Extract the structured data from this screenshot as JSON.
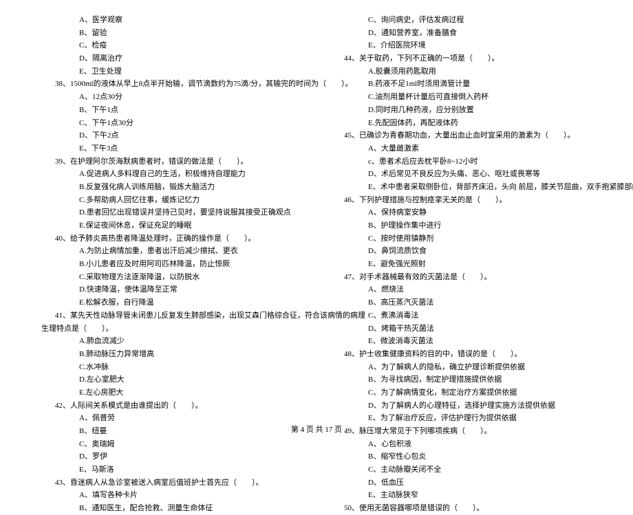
{
  "left_column": [
    {
      "type": "option",
      "text": "A、医学观察"
    },
    {
      "type": "option",
      "text": "B、留验"
    },
    {
      "type": "option",
      "text": "C、检疫"
    },
    {
      "type": "option",
      "text": "D、隔离治疗"
    },
    {
      "type": "option",
      "text": "E、卫生处理"
    },
    {
      "type": "question",
      "text": "38、1500ml的液体从早上8点半开始输，调节滴数约为75滴/分，其输完的时间为（　　）。"
    },
    {
      "type": "option",
      "text": "A、12点30分"
    },
    {
      "type": "option",
      "text": "B、下午1点"
    },
    {
      "type": "option",
      "text": "C、下午1点30分"
    },
    {
      "type": "option",
      "text": "D、下午2点"
    },
    {
      "type": "option",
      "text": "E、下午3点"
    },
    {
      "type": "question",
      "text": "39、在护理阿尔茨海默病患者时，错误的做法是（　　）。"
    },
    {
      "type": "option",
      "text": "A.促进病人多料理自己的生活，积极维持自理能力"
    },
    {
      "type": "option",
      "text": "B.反复强化病人训练用脑，锻炼大脑活力"
    },
    {
      "type": "option",
      "text": "C.多帮助病人回忆往事，缓炼记忆力"
    },
    {
      "type": "option",
      "text": "D.患者回忆出现错误并坚持己见时，要坚持说服其接受正确观点"
    },
    {
      "type": "option",
      "text": "E.保证夜间休息，保证充足的睡眠"
    },
    {
      "type": "question",
      "text": "40、给予肺炎高热患者降温处理时，正确的操作是（　　）。"
    },
    {
      "type": "option",
      "text": "A.为防止病情加重，患者出汗后减少擦拭、更衣"
    },
    {
      "type": "option",
      "text": "B.小儿患者应及时用阿司匹林降温，防止惊厥"
    },
    {
      "type": "option",
      "text": "C.采取物理方法逐渐降温，以防脱水"
    },
    {
      "type": "option",
      "text": "D.快速降温，使体温降至正常"
    },
    {
      "type": "option",
      "text": "E.松解衣服，自行降温"
    },
    {
      "type": "question",
      "text": "41、某先天性动脉导管未闭患儿反复发生肺部感染，出现艾森门格综合征，符合该病情的病理"
    },
    {
      "type": "question-sub",
      "text": "生理特点是（　　）。"
    },
    {
      "type": "option",
      "text": "A.肺血流减少"
    },
    {
      "type": "option",
      "text": "B.肺动脉压力异常增高"
    },
    {
      "type": "option",
      "text": "C.水冲脉"
    },
    {
      "type": "option",
      "text": "D.左心室肥大"
    },
    {
      "type": "option",
      "text": "E.左心房肥大"
    },
    {
      "type": "question",
      "text": "42、人际间关系模式是由谁提出的（　　）。"
    },
    {
      "type": "option",
      "text": "A、佩普劳"
    },
    {
      "type": "option",
      "text": "B、纽曼"
    },
    {
      "type": "option",
      "text": "C、奥瑞姆"
    },
    {
      "type": "option",
      "text": "D、罗伊"
    },
    {
      "type": "option",
      "text": "E、马斯洛"
    },
    {
      "type": "question",
      "text": "43、昏迷病人从急诊室被送入病室后值班护士首先应（　　）。"
    },
    {
      "type": "option",
      "text": "A、填写各种卡片"
    },
    {
      "type": "option",
      "text": "B、通知医生，配合抢救、测量生命体征"
    }
  ],
  "right_column": [
    {
      "type": "option",
      "text": "C、询问病史，评估发病过程"
    },
    {
      "type": "option",
      "text": "D、通知营养室，准备膳食"
    },
    {
      "type": "option",
      "text": "E、介绍医院环境"
    },
    {
      "type": "question",
      "text": "44、关于取药，下列不正确的一项是（　　）。"
    },
    {
      "type": "option",
      "text": "A.胶囊须用药匙取用"
    },
    {
      "type": "option",
      "text": "B.药液不足1ml时须用滴管计量"
    },
    {
      "type": "option",
      "text": "C.油剂用量杯计量后可直接倒入药杯"
    },
    {
      "type": "option",
      "text": "D.同时用几种药液，应分别放置"
    },
    {
      "type": "option",
      "text": "E.先配固体药，再配液体药"
    },
    {
      "type": "question",
      "text": "45、已确诊为青春期功血，大量出血止血时宜采用的激素为（　　）。"
    },
    {
      "type": "option",
      "text": "A、大量雌激素"
    },
    {
      "type": "option",
      "text": "c、患者术后应去枕平卧8~12小时"
    },
    {
      "type": "option",
      "text": "D、术后常见不良反应为头痛、恶心、呕吐或畏寒等"
    },
    {
      "type": "option",
      "text": "E、术中患者采取侧卧位，背部齐床沿，头向 前屈，膝关节屈曲，双手抱紧膝部的姿势"
    },
    {
      "type": "question",
      "text": "46、下列护理措施与控制痉挛无关的是（　　）。"
    },
    {
      "type": "option",
      "text": "A、保持病室安静"
    },
    {
      "type": "option",
      "text": "B、护理操作集中进行"
    },
    {
      "type": "option",
      "text": "C、按时使用镇静剂"
    },
    {
      "type": "option",
      "text": "D、鼻饲流质饮食"
    },
    {
      "type": "option",
      "text": "E、避免强光照射"
    },
    {
      "type": "question",
      "text": "47、对手术器械最有效的灭菌法是（　　）。"
    },
    {
      "type": "option",
      "text": "A、燃烧法"
    },
    {
      "type": "option",
      "text": "B、高压蒸汽灭菌法"
    },
    {
      "type": "option",
      "text": "C、煮沸消毒法"
    },
    {
      "type": "option",
      "text": "D、烤箱干热灭菌法"
    },
    {
      "type": "option",
      "text": "E、微波消毒灭菌法"
    },
    {
      "type": "question",
      "text": "48、护士收集健康资料的目的中，错误的是（　　）。"
    },
    {
      "type": "option",
      "text": "A、为了解病人的隐私，确立护理诊断提供依据"
    },
    {
      "type": "option",
      "text": "B、为寻找病因，制定护理措施提供依据"
    },
    {
      "type": "option",
      "text": "C、为了解病情变化，制定治疗方案提供依据"
    },
    {
      "type": "option",
      "text": "D、为了解病人的心理特征，选择护理实施方法提供依据"
    },
    {
      "type": "option",
      "text": "E、为了解治疗反应，评估护理行为提供依据"
    },
    {
      "type": "question",
      "text": "49、脉压增大常见于下列哪项疾病（　　）。"
    },
    {
      "type": "option",
      "text": "A、心包积液"
    },
    {
      "type": "option",
      "text": "B、缩窄性心包炎"
    },
    {
      "type": "option",
      "text": "C、主动脉瓣关闭不全"
    },
    {
      "type": "option",
      "text": "D、低血压"
    },
    {
      "type": "option",
      "text": "E、主动脉狭窄"
    },
    {
      "type": "question",
      "text": "50、使用无菌容器哪项是错误的（　　）。"
    }
  ],
  "footer": "第 4 页 共 17 页"
}
